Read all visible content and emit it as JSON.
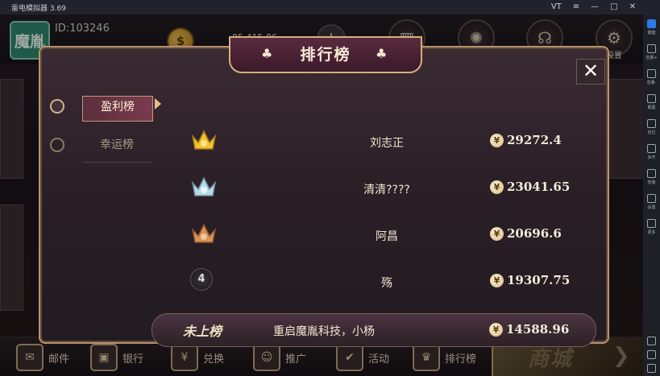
{
  "emulator": {
    "title": "雷电模拟器 3.69",
    "window_controls": [
      "VT",
      "≡",
      "—",
      "□",
      "✕"
    ],
    "sidebar_labels": [
      "键盘",
      "音量+",
      "音量-",
      "截图",
      "定位",
      "多开",
      "安装",
      "设置",
      "更多"
    ]
  },
  "player": {
    "avatar_text": "魔胤",
    "id_text": "ID:103246",
    "coins": "85,415.06"
  },
  "topbar": {
    "settings_label": "设置"
  },
  "modal": {
    "title": "排行榜",
    "close_glyph": "✕",
    "tabs": [
      {
        "label": "盈利榜",
        "active": true
      },
      {
        "label": "幸运榜",
        "active": false
      }
    ],
    "rankings": [
      {
        "rank": 1,
        "badge": "gold-crown",
        "name": "刘志正",
        "amount": "29272.4"
      },
      {
        "rank": 2,
        "badge": "silver-crown",
        "name": "清清????",
        "amount": "23041.65"
      },
      {
        "rank": 3,
        "badge": "bronze-crown",
        "name": "阿昌",
        "amount": "20696.6"
      },
      {
        "rank": 4,
        "badge": "number",
        "name": "殇",
        "amount": "19307.75"
      }
    ],
    "my_row": {
      "status": "未上榜",
      "name": "重启魔胤科技，小杨",
      "amount": "14588.96"
    },
    "currency_symbol": "¥"
  },
  "bottom_nav": {
    "items": [
      {
        "label": "邮件",
        "icon": "mail-icon"
      },
      {
        "label": "银行",
        "icon": "bank-icon"
      },
      {
        "label": "兑换",
        "icon": "exchange-icon"
      },
      {
        "label": "推广",
        "icon": "promote-icon"
      },
      {
        "label": "活动",
        "icon": "activity-icon"
      },
      {
        "label": "排行榜",
        "icon": "trophy-icon"
      }
    ],
    "shop_label": "商城"
  },
  "colors": {
    "accent_gold": "#d3b07e",
    "modal_bg": "#2a1f26",
    "active_tab": "#7a3b4d"
  }
}
